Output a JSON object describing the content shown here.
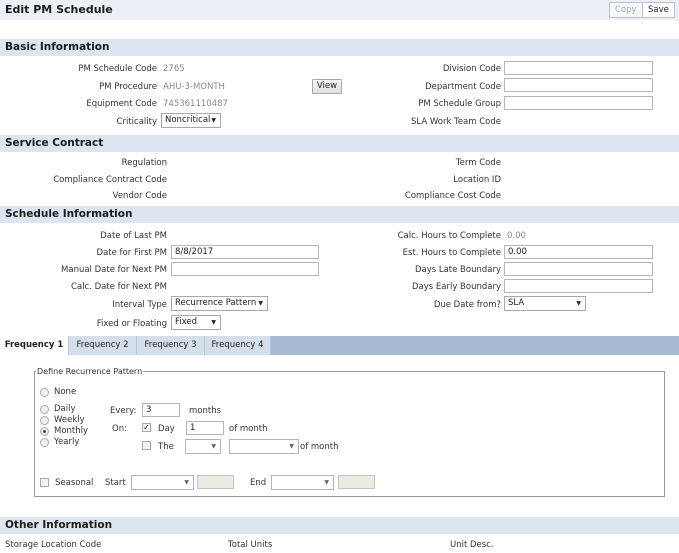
{
  "header": {
    "title": "Edit PM Schedule",
    "copy_label": "Copy",
    "save_label": "Save"
  },
  "basic": {
    "heading": "Basic Information",
    "pm_schedule_code_label": "PM Schedule Code",
    "pm_schedule_code": "2765",
    "pm_procedure_label": "PM Procedure",
    "pm_procedure": "AHU-3-MONTH",
    "view_label": "View",
    "equipment_code_label": "Equipment Code",
    "equipment_code": "745361110487",
    "criticality_label": "Criticality",
    "criticality": "Noncritical",
    "division_code_label": "Division Code",
    "division_code": "",
    "department_code_label": "Department Code",
    "department_code": "",
    "pm_schedule_group_label": "PM Schedule Group",
    "pm_schedule_group": "",
    "sla_work_team_label": "SLA Work Team Code"
  },
  "service": {
    "heading": "Service Contract",
    "regulation_label": "Regulation",
    "compliance_contract_label": "Compliance Contract Code",
    "vendor_code_label": "Vendor Code",
    "term_code_label": "Term Code",
    "location_id_label": "Location ID",
    "compliance_cost_label": "Compliance Cost Code"
  },
  "schedule": {
    "heading": "Schedule Information",
    "last_pm_label": "Date of Last PM",
    "first_pm_label": "Date for First PM",
    "first_pm": "8/8/2017",
    "manual_next_label": "Manual Date for Next PM",
    "manual_next": "",
    "calc_next_label": "Calc. Date for Next PM",
    "interval_type_label": "Interval Type",
    "interval_type": "Recurrence Pattern",
    "fixed_floating_label": "Fixed or Floating",
    "fixed_floating": "Fixed",
    "calc_hours_label": "Calc. Hours to Complete",
    "calc_hours": "0.00",
    "est_hours_label": "Est. Hours to Complete",
    "est_hours": "0.00",
    "days_late_label": "Days Late Boundary",
    "days_late": "",
    "days_early_label": "Days Early Boundary",
    "days_early": "",
    "due_from_label": "Due Date from?",
    "due_from": "SLA"
  },
  "tabs": [
    "Frequency 1",
    "Frequency 2",
    "Frequency 3",
    "Frequency 4"
  ],
  "recurrence": {
    "legend": "Define Recurrence Pattern",
    "none": "None",
    "daily": "Daily",
    "weekly": "Weekly",
    "monthly": "Monthly",
    "yearly": "Yearly",
    "selected": "Monthly",
    "every_label": "Every:",
    "every_value": "3",
    "months_label": "months",
    "on_label": "On:",
    "day_label": "Day",
    "day_value": "1",
    "of_month_1": "of month",
    "the_label": "The",
    "of_month_2": "of month",
    "seasonal_label": "Seasonal",
    "start_label": "Start",
    "end_label": "End"
  },
  "other": {
    "heading": "Other Information",
    "storage_label": "Storage Location Code",
    "total_units_label": "Total Units",
    "unit_desc_label": "Unit Desc."
  }
}
